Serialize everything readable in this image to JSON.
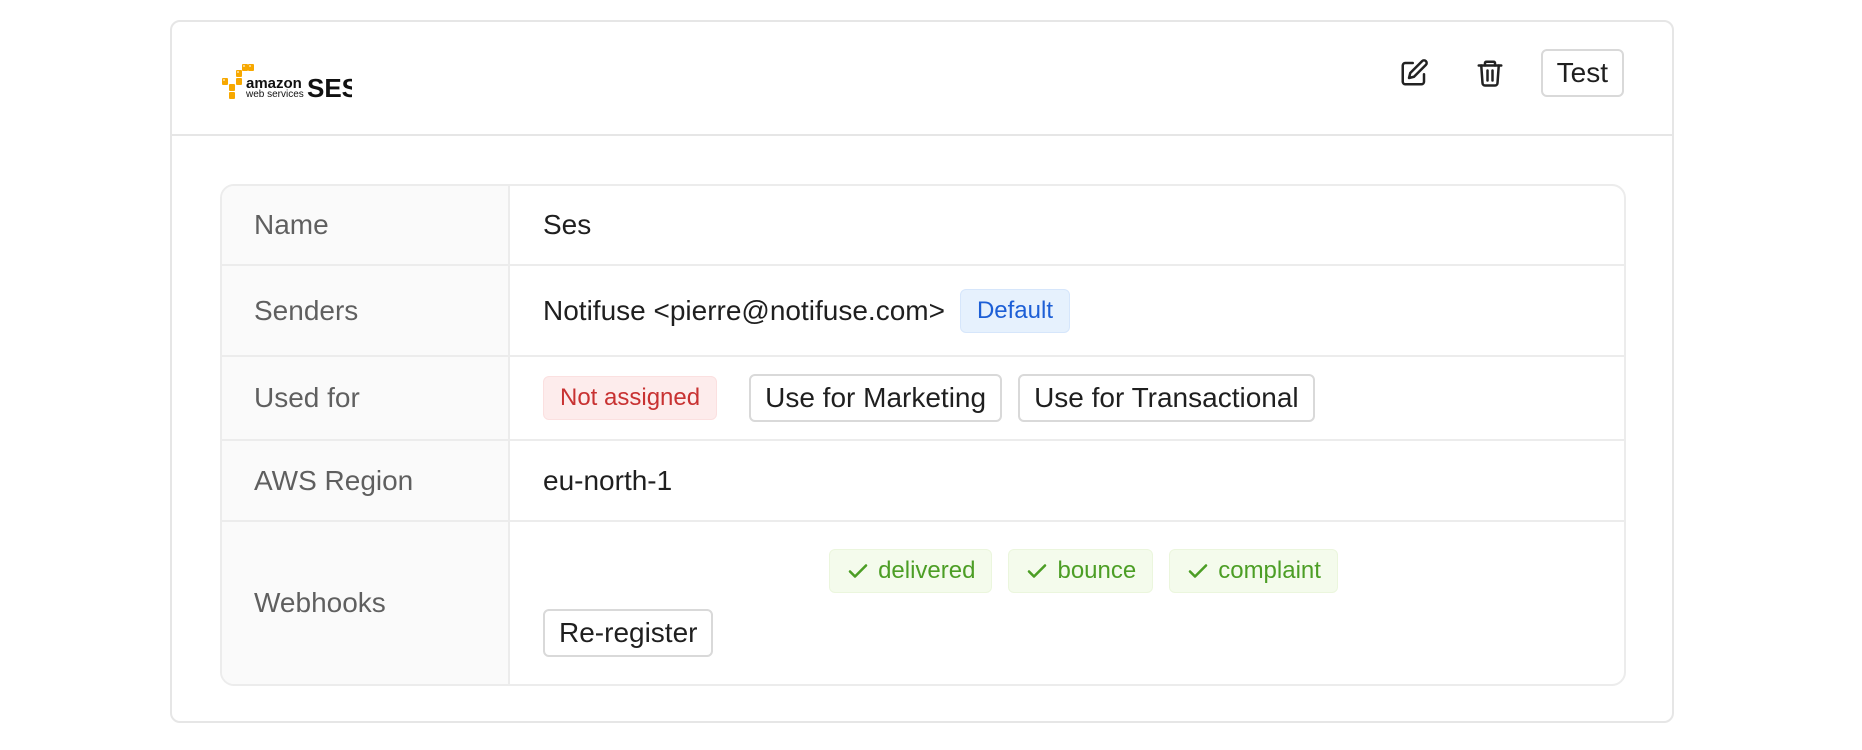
{
  "provider": {
    "logo_word_1": "amazon",
    "logo_word_2": "web services",
    "logo_word_3": "SES",
    "logo_color": "#f7a800"
  },
  "header": {
    "edit_icon": "edit-icon",
    "delete_icon": "trash-icon",
    "test_label": "Test"
  },
  "details": {
    "name": {
      "label": "Name",
      "value": "Ses"
    },
    "senders": {
      "label": "Senders",
      "value": "Notifuse <pierre@notifuse.com>",
      "default_tag": "Default"
    },
    "used_for": {
      "label": "Used for",
      "status": "Not assigned",
      "marketing_button": "Use for Marketing",
      "transactional_button": "Use for Transactional"
    },
    "region": {
      "label": "AWS Region",
      "value": "eu-north-1"
    },
    "webhooks": {
      "label": "Webhooks",
      "events": [
        "delivered",
        "bounce",
        "complaint"
      ],
      "reregister_button": "Re-register"
    }
  },
  "colors": {
    "accent_blue": "#1d5fd6",
    "danger_red": "#c83232",
    "success_green": "#4c9e25"
  }
}
